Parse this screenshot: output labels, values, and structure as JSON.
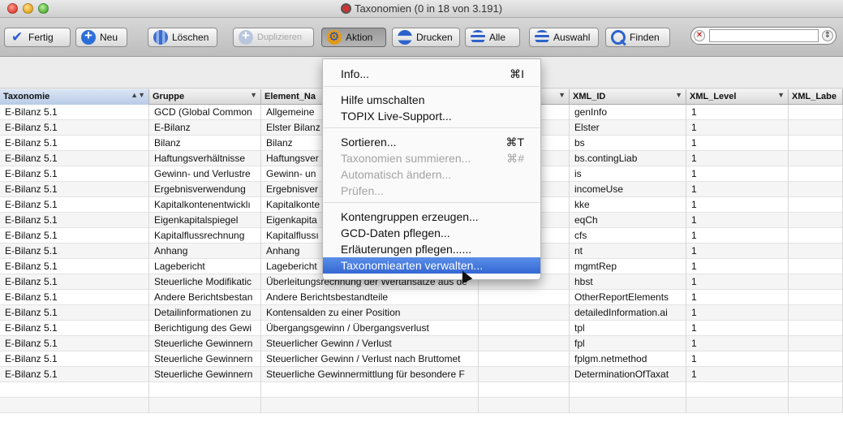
{
  "window": {
    "title": "Taxonomien (0 in 18 von 3.191)"
  },
  "toolbar": {
    "fertig": "Fertig",
    "neu": "Neu",
    "loeschen": "Löschen",
    "duplizieren": "Duplizieren",
    "aktion": "Aktion",
    "drucken": "Drucken",
    "alle": "Alle",
    "auswahl": "Auswahl",
    "finden": "Finden",
    "search_value": ""
  },
  "columns": [
    "Taxonomie",
    "Gruppe",
    "Element_Na",
    "",
    "XML_ID",
    "XML_Level",
    "XML_Labe"
  ],
  "rows": [
    [
      "E-Bilanz 5.1",
      "GCD (Global Common",
      "Allgemeine",
      "",
      "genInfo",
      "1"
    ],
    [
      "E-Bilanz 5.1",
      "E-Bilanz",
      "Elster Bilanz",
      "",
      "Elster",
      "1"
    ],
    [
      "E-Bilanz 5.1",
      "Bilanz",
      "Bilanz",
      "",
      "bs",
      "1"
    ],
    [
      "E-Bilanz 5.1",
      "Haftungsverhältnisse",
      "Haftungsver",
      "",
      "bs.contingLiab",
      "1"
    ],
    [
      "E-Bilanz 5.1",
      "Gewinn- und Verlustre",
      "Gewinn- un",
      "",
      "is",
      "1"
    ],
    [
      "E-Bilanz 5.1",
      "Ergebnisverwendung",
      "Ergebnisver",
      "",
      "incomeUse",
      "1"
    ],
    [
      "E-Bilanz 5.1",
      "Kapitalkontenentwicklı",
      "Kapitalkonte",
      "",
      "kke",
      "1"
    ],
    [
      "E-Bilanz 5.1",
      "Eigenkapitalspiegel",
      "Eigenkapita",
      "",
      "eqCh",
      "1"
    ],
    [
      "E-Bilanz 5.1",
      "Kapitalflussrechnung",
      "Kapitalflussı",
      "",
      "cfs",
      "1"
    ],
    [
      "E-Bilanz 5.1",
      "Anhang",
      "Anhang",
      "",
      "nt",
      "1"
    ],
    [
      "E-Bilanz 5.1",
      "Lagebericht",
      "Lagebericht",
      "",
      "mgmtRep",
      "1"
    ],
    [
      "E-Bilanz 5.1",
      "Steuerliche Modifikatic",
      "Überleitungsrechnung der Wertansätze aus de",
      "",
      "hbst",
      "1"
    ],
    [
      "E-Bilanz 5.1",
      "Andere Berichtsbestan",
      "Andere Berichtsbestandteile",
      "",
      "OtherReportElements",
      "1"
    ],
    [
      "E-Bilanz 5.1",
      "Detailinformationen zu",
      "Kontensalden zu einer Position",
      "",
      "detailedInformation.ai",
      "1"
    ],
    [
      "E-Bilanz 5.1",
      "Berichtigung des Gewi",
      "Übergangsgewinn / Übergangsverlust",
      "",
      "tpl",
      "1"
    ],
    [
      "E-Bilanz 5.1",
      "Steuerliche Gewinnern",
      "Steuerlicher Gewinn / Verlust",
      "",
      "fpl",
      "1"
    ],
    [
      "E-Bilanz 5.1",
      "Steuerliche Gewinnern",
      "Steuerlicher Gewinn / Verlust nach Bruttomet",
      "",
      "fplgm.netmethod",
      "1"
    ],
    [
      "E-Bilanz 5.1",
      "Steuerliche Gewinnern",
      "Steuerliche Gewinnermittlung für besondere F",
      "",
      "DeterminationOfTaxat",
      "1"
    ]
  ],
  "menu": {
    "items": [
      {
        "label": "Info...",
        "shortcut": "⌘I",
        "disabled": false
      },
      {
        "label": "Hilfe umschalten",
        "shortcut": "",
        "disabled": false
      },
      {
        "label": "TOPIX Live-Support...",
        "shortcut": "",
        "disabled": false
      },
      {
        "label": "Sortieren...",
        "shortcut": "⌘T",
        "disabled": false
      },
      {
        "label": "Taxonomien summieren...",
        "shortcut": "⌘#",
        "disabled": true
      },
      {
        "label": "Automatisch ändern...",
        "shortcut": "",
        "disabled": true
      },
      {
        "label": "Prüfen...",
        "shortcut": "",
        "disabled": true
      },
      {
        "label": "Kontengruppen erzeugen...",
        "shortcut": "",
        "disabled": false
      },
      {
        "label": "GCD-Daten pflegen...",
        "shortcut": "",
        "disabled": false
      },
      {
        "label": "Erläuterungen pflegen......",
        "shortcut": "",
        "disabled": false
      },
      {
        "label": "Taxonomiearten verwalten...",
        "shortcut": "",
        "disabled": false
      }
    ]
  }
}
